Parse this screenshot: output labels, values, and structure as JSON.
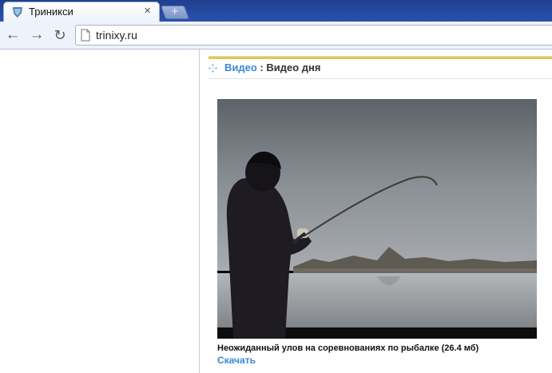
{
  "browser": {
    "tab": {
      "title": "Триникси",
      "favicon": "trinixy-shield-icon",
      "close_glyph": "×"
    },
    "new_tab_glyph": "+",
    "toolbar": {
      "back_glyph": "←",
      "forward_glyph": "→",
      "reload_glyph": "↻",
      "url": "trinixy.ru"
    }
  },
  "section": {
    "category_link": "Видео",
    "separator": " : ",
    "title": "Видео дня"
  },
  "video": {
    "thumbnail": "man-fishing-on-river-image",
    "caption": "Неожиданный улов на соревнованиях по рыбалке (26.4 мб)",
    "download_label": "Скачать"
  },
  "colors": {
    "titlebar": "#2a52ad",
    "link": "#3a86d6",
    "gold_rule": "#e2c55a"
  }
}
